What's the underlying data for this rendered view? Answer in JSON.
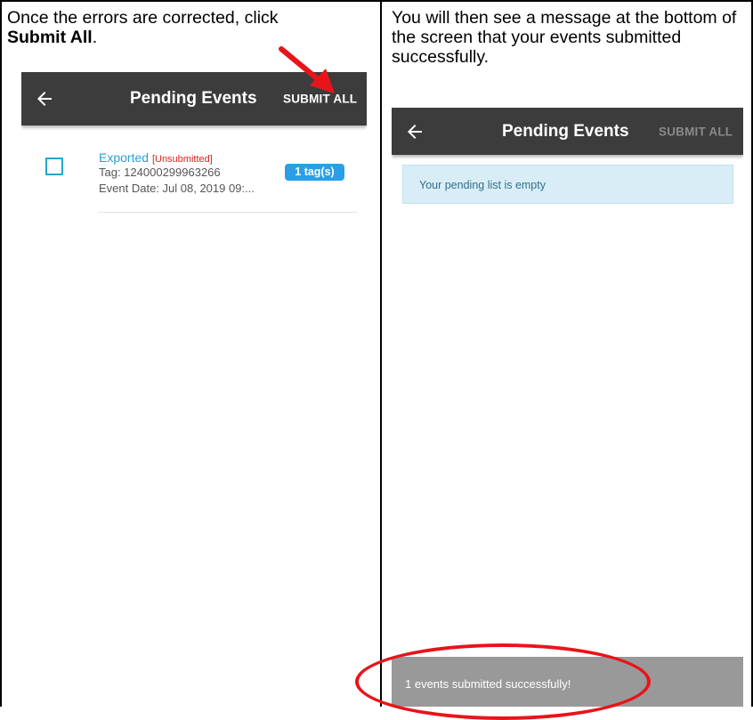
{
  "captions": {
    "left_line1": "Once the errors are corrected, click",
    "left_bold": "Submit All",
    "left_after_bold": ".",
    "right": "You will then see a message at the bottom of the screen that your events submitted successfully."
  },
  "screen_before": {
    "appbar": {
      "title": "Pending Events",
      "action": "SUBMIT ALL",
      "back_icon": "arrow-left-icon"
    },
    "events": [
      {
        "status": "Exported",
        "status_flag": "[Unsubmitted]",
        "tag": "Tag: 124000299963266",
        "date": "Event Date: Jul 08, 2019 09:...",
        "badge": "1 tag(s)"
      }
    ]
  },
  "screen_after": {
    "appbar": {
      "title": "Pending Events",
      "action": "SUBMIT ALL",
      "back_icon": "arrow-left-icon"
    },
    "empty_message": "Your pending list is empty",
    "snackbar": "1 events submitted successfully!"
  },
  "colors": {
    "appbar": "#3c3c3c",
    "accent_blue": "#2a9fd6",
    "unsubmitted_red": "#e02020",
    "annotation_red": "#e8141a",
    "alert_bg": "#d9edf7",
    "snackbar_bg": "#999999"
  }
}
